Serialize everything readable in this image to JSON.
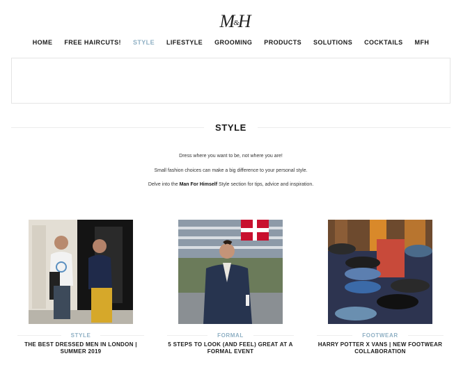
{
  "header": {
    "logo_m": "M",
    "logo_amp": "&",
    "logo_h": "H"
  },
  "nav": {
    "items": [
      {
        "label": "HOME"
      },
      {
        "label": "FREE HAIRCUTS!"
      },
      {
        "label": "STYLE"
      },
      {
        "label": "LIFESTYLE"
      },
      {
        "label": "GROOMING"
      },
      {
        "label": "PRODUCTS"
      },
      {
        "label": "SOLUTIONS"
      },
      {
        "label": "COCKTAILS"
      },
      {
        "label": "MFH"
      }
    ],
    "active": "STYLE"
  },
  "section": {
    "title": "STYLE",
    "intro_line1": "Dress where you want to be, not where you are!",
    "intro_line2": "Small fashion choices can make a big difference to your personal style.",
    "intro_line3_pre": "Delve into the ",
    "intro_line3_bold": "Man For Himself",
    "intro_line3_post": " Style section for tips, advice and inspiration."
  },
  "articles": [
    {
      "category": "STYLE",
      "title": "THE BEST DRESSED MEN IN LONDON | SUMMER 2019"
    },
    {
      "category": "FORMAL",
      "title": "5 STEPS TO LOOK (AND FEEL) GREAT AT A FORMAL EVENT"
    },
    {
      "category": "FOOTWEAR",
      "title": "HARRY POTTER X VANS | NEW FOOTWEAR COLLABORATION"
    }
  ],
  "colors": {
    "accent": "#8fb0c4",
    "text": "#1a1a1a"
  }
}
